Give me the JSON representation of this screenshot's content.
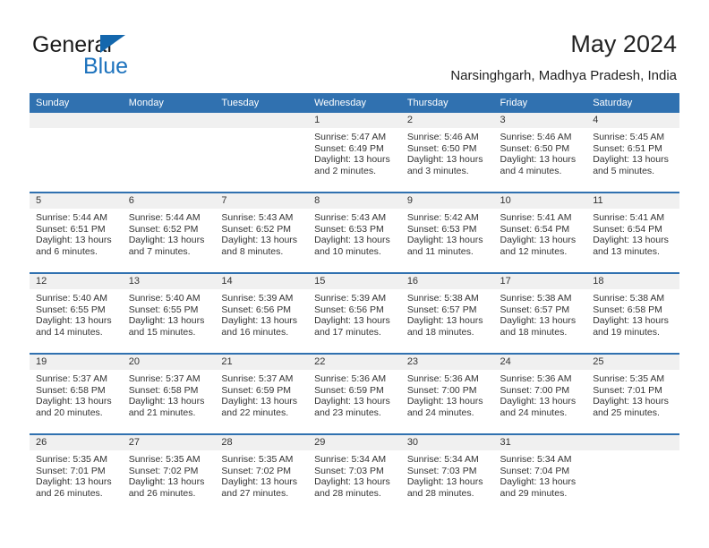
{
  "brand": {
    "name_part1": "General",
    "name_part2": "Blue",
    "triangle_icon": "triangle-icon",
    "accent_color": "#1c72bd"
  },
  "header": {
    "title": "May 2024",
    "subtitle": "Narsinghgarh, Madhya Pradesh, India"
  },
  "colors": {
    "header_blue": "#3071b0",
    "day_band_gray": "#f0f0f0",
    "text": "#333333"
  },
  "weekdays": [
    "Sunday",
    "Monday",
    "Tuesday",
    "Wednesday",
    "Thursday",
    "Friday",
    "Saturday"
  ],
  "labels": {
    "sunrise": "Sunrise:",
    "sunset": "Sunset:",
    "daylight": "Daylight:"
  },
  "weeks": [
    [
      {
        "day": "",
        "empty": true
      },
      {
        "day": "",
        "empty": true
      },
      {
        "day": "",
        "empty": true
      },
      {
        "day": "1",
        "sunrise": "Sunrise: 5:47 AM",
        "sunset": "Sunset: 6:49 PM",
        "daylight_line1": "Daylight: 13 hours",
        "daylight_line2": "and 2 minutes."
      },
      {
        "day": "2",
        "sunrise": "Sunrise: 5:46 AM",
        "sunset": "Sunset: 6:50 PM",
        "daylight_line1": "Daylight: 13 hours",
        "daylight_line2": "and 3 minutes."
      },
      {
        "day": "3",
        "sunrise": "Sunrise: 5:46 AM",
        "sunset": "Sunset: 6:50 PM",
        "daylight_line1": "Daylight: 13 hours",
        "daylight_line2": "and 4 minutes."
      },
      {
        "day": "4",
        "sunrise": "Sunrise: 5:45 AM",
        "sunset": "Sunset: 6:51 PM",
        "daylight_line1": "Daylight: 13 hours",
        "daylight_line2": "and 5 minutes."
      }
    ],
    [
      {
        "day": "5",
        "sunrise": "Sunrise: 5:44 AM",
        "sunset": "Sunset: 6:51 PM",
        "daylight_line1": "Daylight: 13 hours",
        "daylight_line2": "and 6 minutes."
      },
      {
        "day": "6",
        "sunrise": "Sunrise: 5:44 AM",
        "sunset": "Sunset: 6:52 PM",
        "daylight_line1": "Daylight: 13 hours",
        "daylight_line2": "and 7 minutes."
      },
      {
        "day": "7",
        "sunrise": "Sunrise: 5:43 AM",
        "sunset": "Sunset: 6:52 PM",
        "daylight_line1": "Daylight: 13 hours",
        "daylight_line2": "and 8 minutes."
      },
      {
        "day": "8",
        "sunrise": "Sunrise: 5:43 AM",
        "sunset": "Sunset: 6:53 PM",
        "daylight_line1": "Daylight: 13 hours",
        "daylight_line2": "and 10 minutes."
      },
      {
        "day": "9",
        "sunrise": "Sunrise: 5:42 AM",
        "sunset": "Sunset: 6:53 PM",
        "daylight_line1": "Daylight: 13 hours",
        "daylight_line2": "and 11 minutes."
      },
      {
        "day": "10",
        "sunrise": "Sunrise: 5:41 AM",
        "sunset": "Sunset: 6:54 PM",
        "daylight_line1": "Daylight: 13 hours",
        "daylight_line2": "and 12 minutes."
      },
      {
        "day": "11",
        "sunrise": "Sunrise: 5:41 AM",
        "sunset": "Sunset: 6:54 PM",
        "daylight_line1": "Daylight: 13 hours",
        "daylight_line2": "and 13 minutes."
      }
    ],
    [
      {
        "day": "12",
        "sunrise": "Sunrise: 5:40 AM",
        "sunset": "Sunset: 6:55 PM",
        "daylight_line1": "Daylight: 13 hours",
        "daylight_line2": "and 14 minutes."
      },
      {
        "day": "13",
        "sunrise": "Sunrise: 5:40 AM",
        "sunset": "Sunset: 6:55 PM",
        "daylight_line1": "Daylight: 13 hours",
        "daylight_line2": "and 15 minutes."
      },
      {
        "day": "14",
        "sunrise": "Sunrise: 5:39 AM",
        "sunset": "Sunset: 6:56 PM",
        "daylight_line1": "Daylight: 13 hours",
        "daylight_line2": "and 16 minutes."
      },
      {
        "day": "15",
        "sunrise": "Sunrise: 5:39 AM",
        "sunset": "Sunset: 6:56 PM",
        "daylight_line1": "Daylight: 13 hours",
        "daylight_line2": "and 17 minutes."
      },
      {
        "day": "16",
        "sunrise": "Sunrise: 5:38 AM",
        "sunset": "Sunset: 6:57 PM",
        "daylight_line1": "Daylight: 13 hours",
        "daylight_line2": "and 18 minutes."
      },
      {
        "day": "17",
        "sunrise": "Sunrise: 5:38 AM",
        "sunset": "Sunset: 6:57 PM",
        "daylight_line1": "Daylight: 13 hours",
        "daylight_line2": "and 18 minutes."
      },
      {
        "day": "18",
        "sunrise": "Sunrise: 5:38 AM",
        "sunset": "Sunset: 6:58 PM",
        "daylight_line1": "Daylight: 13 hours",
        "daylight_line2": "and 19 minutes."
      }
    ],
    [
      {
        "day": "19",
        "sunrise": "Sunrise: 5:37 AM",
        "sunset": "Sunset: 6:58 PM",
        "daylight_line1": "Daylight: 13 hours",
        "daylight_line2": "and 20 minutes."
      },
      {
        "day": "20",
        "sunrise": "Sunrise: 5:37 AM",
        "sunset": "Sunset: 6:58 PM",
        "daylight_line1": "Daylight: 13 hours",
        "daylight_line2": "and 21 minutes."
      },
      {
        "day": "21",
        "sunrise": "Sunrise: 5:37 AM",
        "sunset": "Sunset: 6:59 PM",
        "daylight_line1": "Daylight: 13 hours",
        "daylight_line2": "and 22 minutes."
      },
      {
        "day": "22",
        "sunrise": "Sunrise: 5:36 AM",
        "sunset": "Sunset: 6:59 PM",
        "daylight_line1": "Daylight: 13 hours",
        "daylight_line2": "and 23 minutes."
      },
      {
        "day": "23",
        "sunrise": "Sunrise: 5:36 AM",
        "sunset": "Sunset: 7:00 PM",
        "daylight_line1": "Daylight: 13 hours",
        "daylight_line2": "and 24 minutes."
      },
      {
        "day": "24",
        "sunrise": "Sunrise: 5:36 AM",
        "sunset": "Sunset: 7:00 PM",
        "daylight_line1": "Daylight: 13 hours",
        "daylight_line2": "and 24 minutes."
      },
      {
        "day": "25",
        "sunrise": "Sunrise: 5:35 AM",
        "sunset": "Sunset: 7:01 PM",
        "daylight_line1": "Daylight: 13 hours",
        "daylight_line2": "and 25 minutes."
      }
    ],
    [
      {
        "day": "26",
        "sunrise": "Sunrise: 5:35 AM",
        "sunset": "Sunset: 7:01 PM",
        "daylight_line1": "Daylight: 13 hours",
        "daylight_line2": "and 26 minutes."
      },
      {
        "day": "27",
        "sunrise": "Sunrise: 5:35 AM",
        "sunset": "Sunset: 7:02 PM",
        "daylight_line1": "Daylight: 13 hours",
        "daylight_line2": "and 26 minutes."
      },
      {
        "day": "28",
        "sunrise": "Sunrise: 5:35 AM",
        "sunset": "Sunset: 7:02 PM",
        "daylight_line1": "Daylight: 13 hours",
        "daylight_line2": "and 27 minutes."
      },
      {
        "day": "29",
        "sunrise": "Sunrise: 5:34 AM",
        "sunset": "Sunset: 7:03 PM",
        "daylight_line1": "Daylight: 13 hours",
        "daylight_line2": "and 28 minutes."
      },
      {
        "day": "30",
        "sunrise": "Sunrise: 5:34 AM",
        "sunset": "Sunset: 7:03 PM",
        "daylight_line1": "Daylight: 13 hours",
        "daylight_line2": "and 28 minutes."
      },
      {
        "day": "31",
        "sunrise": "Sunrise: 5:34 AM",
        "sunset": "Sunset: 7:04 PM",
        "daylight_line1": "Daylight: 13 hours",
        "daylight_line2": "and 29 minutes."
      },
      {
        "day": "",
        "empty": true
      }
    ]
  ]
}
